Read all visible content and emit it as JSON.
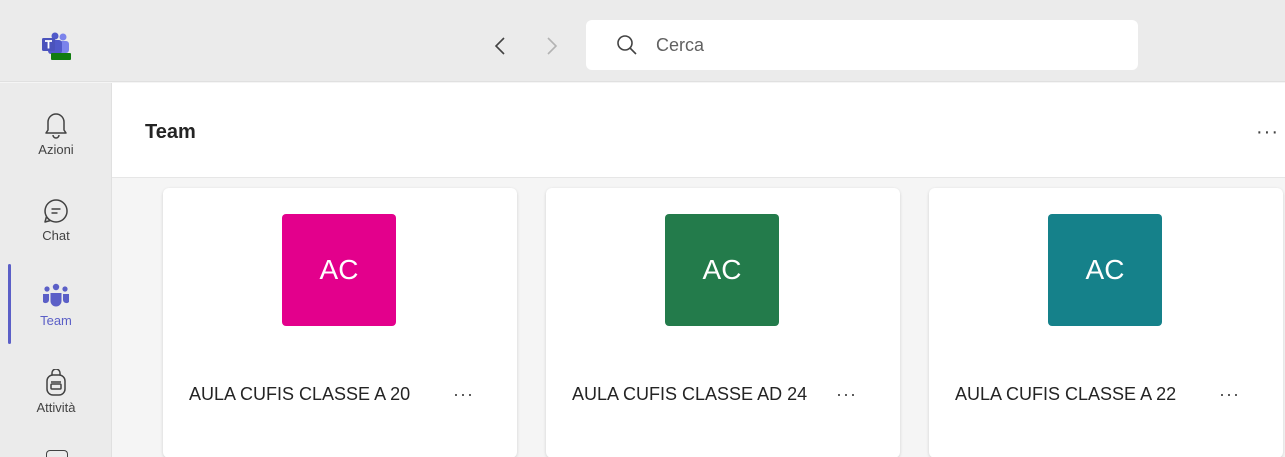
{
  "titlebar": {
    "logo_badge": "NEW",
    "search_placeholder": "Cerca"
  },
  "rail": {
    "items": [
      {
        "label": "Azioni",
        "icon": "bell-icon"
      },
      {
        "label": "Chat",
        "icon": "chat-icon"
      },
      {
        "label": "Team",
        "icon": "teams-icon",
        "active": true
      },
      {
        "label": "Attività",
        "icon": "backpack-icon"
      }
    ]
  },
  "main": {
    "title": "Team",
    "more": "···"
  },
  "cards": [
    {
      "initials": "AC",
      "name": "AULA CUFIS CLASSE A 20",
      "color": "#e3008c",
      "more": "···"
    },
    {
      "initials": "AC",
      "name": "AULA CUFIS CLASSE AD 24",
      "color": "#237b4b",
      "more": "···"
    },
    {
      "initials": "AC",
      "name": "AULA CUFIS CLASSE A 22",
      "color": "#15818a",
      "more": "···"
    }
  ],
  "colors": {
    "accent": "#5b5fc7",
    "rail_bg": "#ebebeb",
    "content_bg": "#f5f5f5"
  }
}
